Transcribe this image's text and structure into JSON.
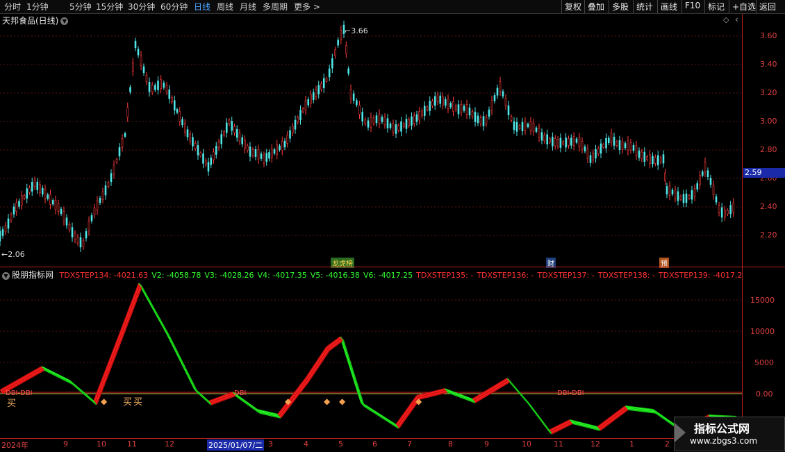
{
  "toolbar": {
    "periods": [
      "分时",
      "1分钟",
      "5分钟",
      "15分钟",
      "30分钟",
      "60分钟",
      "日线",
      "周线",
      "月线",
      "多周期",
      "更多"
    ],
    "active_period": "日线",
    "right_buttons": [
      "复权",
      "叠加",
      "多股",
      "统计",
      "画线",
      "F10",
      "标记",
      "+自选",
      "返回"
    ]
  },
  "main_chart": {
    "title": "天邦食品(日线)",
    "high_label": "3.66",
    "low_label": "2.06",
    "current_price": "2.59",
    "y_ticks": [
      "3.60",
      "3.40",
      "3.20",
      "3.00",
      "2.80",
      "2.60",
      "2.40",
      "2.20"
    ],
    "tags": [
      "龙虎榜",
      "财",
      "预"
    ]
  },
  "indicator": {
    "name": "股朋指标网",
    "legend": [
      {
        "text": "TDXSTEP134: -4021.63",
        "color": "#ff3333"
      },
      {
        "text": "V2: -4058.78",
        "color": "#33ff33"
      },
      {
        "text": "V3: -4028.26",
        "color": "#33ff33"
      },
      {
        "text": "V4: -4017.35",
        "color": "#33ff33"
      },
      {
        "text": "V5: -4016.38",
        "color": "#33ff33"
      },
      {
        "text": "V6: -4017.25",
        "color": "#33ff33"
      },
      {
        "text": "TDXSTEP135: -",
        "color": "#ff3333"
      },
      {
        "text": "TDXSTEP136: -",
        "color": "#ff3333"
      },
      {
        "text": "TDXSTEP137: -",
        "color": "#ff3333"
      },
      {
        "text": "TDXSTEP138: -",
        "color": "#ff3333"
      },
      {
        "text": "TDXSTEP139: -4017.2",
        "color": "#ff3333"
      }
    ],
    "y_ticks": [
      "15000",
      "10000",
      "5000",
      "0.00"
    ],
    "annotations": [
      "DBI-DBI",
      "买",
      "买",
      "买",
      "DBI",
      "DBI-DBI"
    ]
  },
  "date_axis": {
    "labels": [
      "2024年",
      "9",
      "10",
      "11",
      "12",
      "2025/01/07/二",
      "3",
      "4",
      "5",
      "6",
      "7",
      "8",
      "9",
      "10",
      "11",
      "12",
      "1",
      "2"
    ],
    "selected": "2025/01/07/二"
  },
  "watermark": {
    "line1": "指标公式网",
    "line2": "www.zbgs3.com"
  }
}
